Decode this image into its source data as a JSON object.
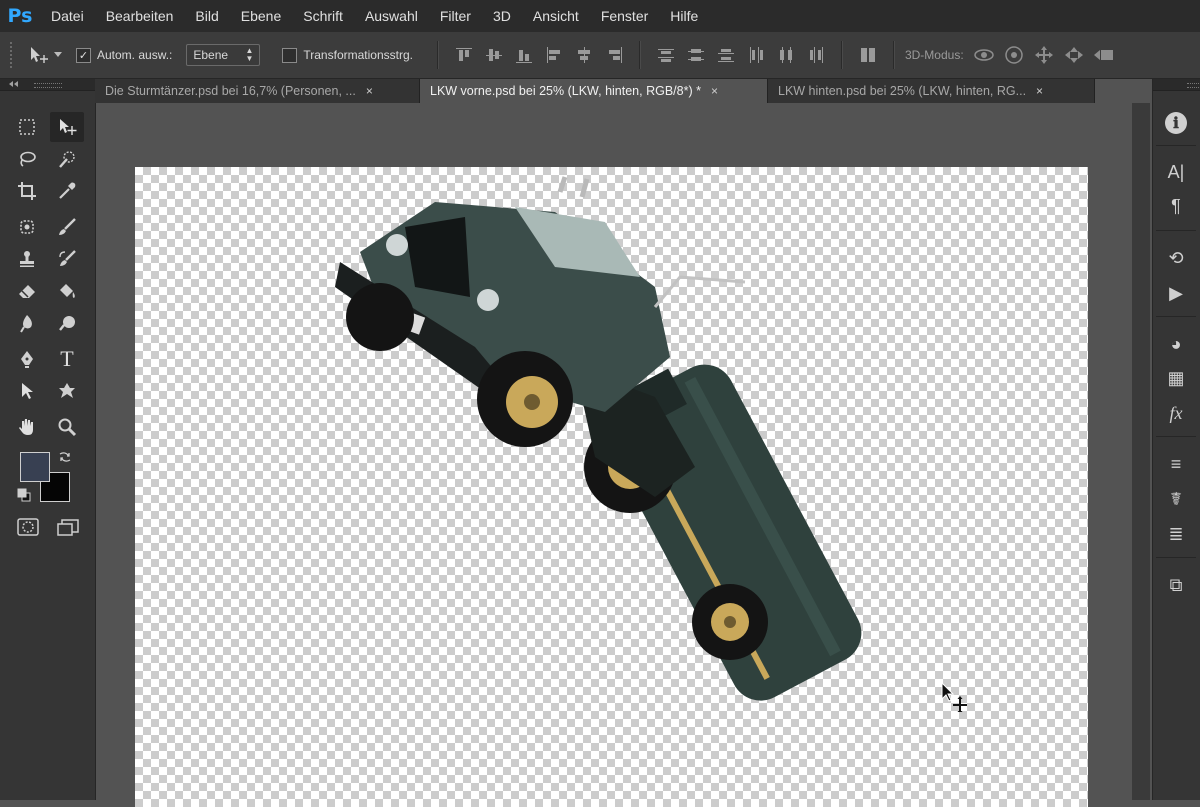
{
  "app": {
    "logo": "Ps"
  },
  "menu": [
    "Datei",
    "Bearbeiten",
    "Bild",
    "Ebene",
    "Schrift",
    "Auswahl",
    "Filter",
    "3D",
    "Ansicht",
    "Fenster",
    "Hilfe"
  ],
  "options": {
    "auto_select_label": "Autom. ausw.:",
    "auto_select_checked": "✓",
    "layer_select_value": "Ebene",
    "transform_label": "Transformationsstrg.",
    "mode_3d_label": "3D-Modus:"
  },
  "tabs": [
    {
      "title": "Die Sturmtänzer.psd bei 16,7% (Personen, ...",
      "close": "×"
    },
    {
      "title": "LKW vorne.psd bei 25% (LKW, hinten, RGB/8*) *",
      "close": "×"
    },
    {
      "title": "LKW hinten.psd bei 25% (LKW, hinten, RG...",
      "close": "×"
    }
  ],
  "colors": {
    "foreground": "#384052",
    "background": "#050505",
    "truck_body": "#2c3d3a",
    "wheel_rim": "#c9a85a"
  },
  "icons": {
    "tools": [
      "marquee-icon",
      "move-icon",
      "lasso-icon",
      "quick-select-icon",
      "crop-icon",
      "eyedropper-icon",
      "spot-heal-icon",
      "brush-icon",
      "stamp-icon",
      "history-brush-icon",
      "eraser-icon",
      "paint-bucket-icon",
      "blur-icon",
      "dodge-icon",
      "pen-icon",
      "type-icon",
      "path-select-icon",
      "shape-icon",
      "hand-icon",
      "zoom-icon"
    ],
    "right_panel": [
      "info-icon",
      "character-icon",
      "paragraph-icon",
      "history-icon",
      "actions-icon",
      "color-icon",
      "swatches-icon",
      "styles-icon",
      "adjustments-icon",
      "brush-presets-icon",
      "layers-icon",
      "3d-icon"
    ]
  },
  "type_tool_glyph": "T",
  "right_panel_glyphs": [
    "ℹ",
    "A|",
    "¶",
    "⟲",
    "▶",
    "◕",
    "▦",
    "fx",
    "≡",
    "☤",
    "≣",
    "⧉"
  ]
}
